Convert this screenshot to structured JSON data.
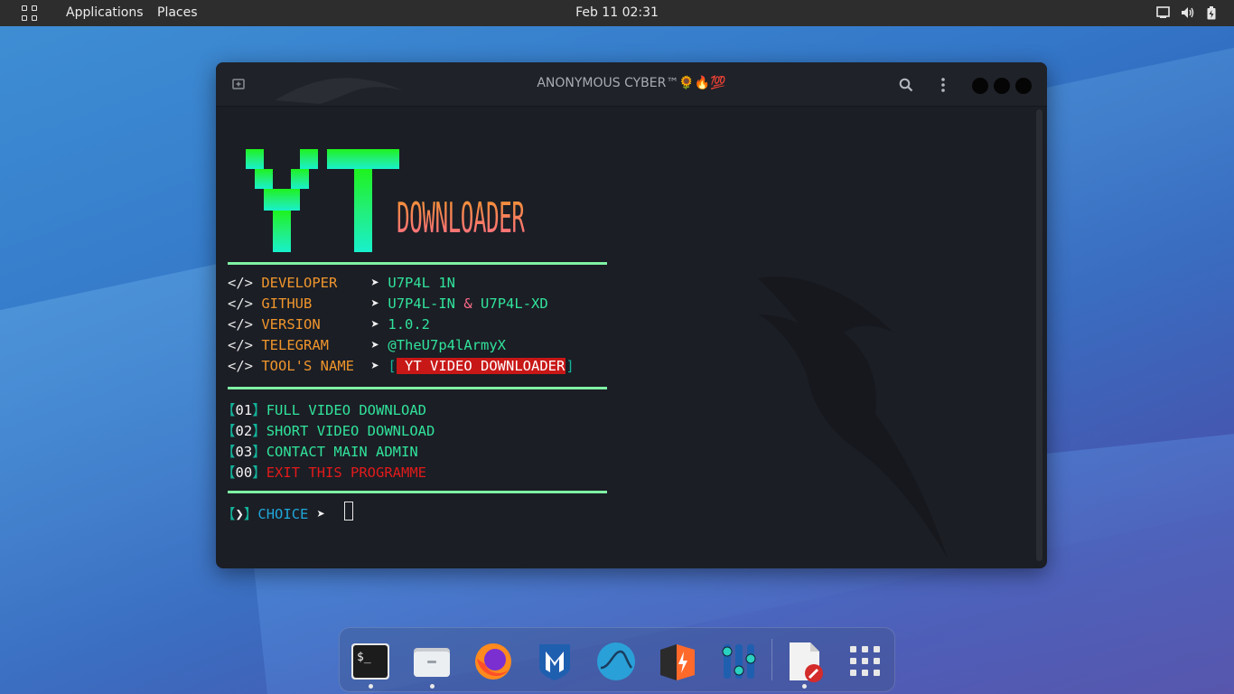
{
  "topbar": {
    "applications": "Applications",
    "places": "Places",
    "clock": "Feb 11  02:31"
  },
  "window": {
    "title": "ANONYMOUS CYBER™🌻🔥💯"
  },
  "banner": {
    "big": "YT",
    "small": "DOWNLOADER"
  },
  "info": [
    {
      "prefix": "</>",
      "key": "DEVELOPER    ",
      "arrow": "➤",
      "value": "U7P4L 1N"
    },
    {
      "prefix": "</>",
      "key": "GITHUB       ",
      "arrow": "➤",
      "value": "U7P4L-IN",
      "amp": "&",
      "value2": "U7P4L-XD"
    },
    {
      "prefix": "</>",
      "key": "VERSION      ",
      "arrow": "➤",
      "value": "1.0.2"
    },
    {
      "prefix": "</>",
      "key": "TELEGRAM     ",
      "arrow": "➤",
      "value": "@TheU7p4lArmyX"
    },
    {
      "prefix": "</>",
      "key": "TOOL'S NAME  ",
      "arrow": "➤",
      "open": "[",
      "value": " YT VIDEO DOWNLOADER",
      "close": "]"
    }
  ],
  "menu": [
    {
      "open": "【",
      "num": "01",
      "close": "】",
      "label": "FULL VIDEO DOWNLOAD"
    },
    {
      "open": "【",
      "num": "02",
      "close": "】",
      "label": "SHORT VIDEO DOWNLOAD"
    },
    {
      "open": "【",
      "num": "03",
      "close": "】",
      "label": "CONTACT MAIN ADMIN"
    },
    {
      "open": "【",
      "num": "00",
      "close": "】",
      "label": "EXIT THIS PROGRAMME"
    }
  ],
  "prompt": {
    "open": "【",
    "sym": "❯",
    "close": "】",
    "label": "CHOICE",
    "arrow": "➤"
  },
  "dock": {
    "apps": [
      "terminal-icon",
      "files-icon",
      "firefox-icon",
      "metasploit-icon",
      "wireshark-icon",
      "burpsuite-icon",
      "settings-mixer-icon",
      "text-editor-icon",
      "app-grid-icon"
    ]
  },
  "colors": {
    "terminal_bg": "#1b1e25",
    "accent_green": "#31e39b",
    "accent_orange": "#f0952c",
    "exit_red": "#e01b1b"
  }
}
